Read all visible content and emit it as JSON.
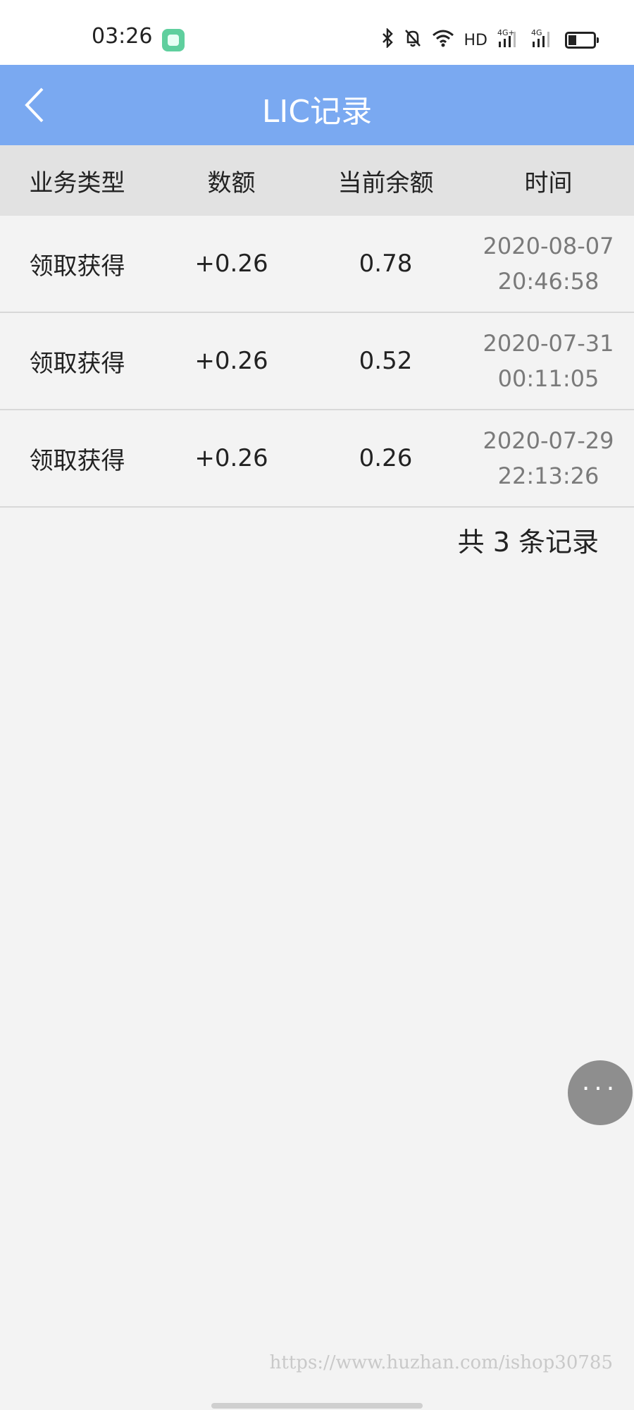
{
  "status_bar": {
    "time": "03:26",
    "icons": [
      "bluetooth-icon",
      "mute-icon",
      "wifi-icon",
      "hd-icon",
      "signal-4g-plus-icon",
      "signal-4g-icon",
      "battery-icon"
    ],
    "hd_label": "HD",
    "net1_label": "4G+",
    "net2_label": "4G"
  },
  "nav": {
    "title": "LIC记录",
    "back_icon": "chevron-left-icon"
  },
  "table": {
    "headers": [
      "业务类型",
      "数额",
      "当前余额",
      "时间"
    ],
    "rows": [
      {
        "type": "领取获得",
        "amount": "+0.26",
        "balance": "0.78",
        "date": "2020-08-07",
        "time": "20:46:58"
      },
      {
        "type": "领取获得",
        "amount": "+0.26",
        "balance": "0.52",
        "date": "2020-07-31",
        "time": "00:11:05"
      },
      {
        "type": "领取获得",
        "amount": "+0.26",
        "balance": "0.26",
        "date": "2020-07-29",
        "time": "22:13:26"
      }
    ]
  },
  "summary": {
    "total_text": "共 3 条记录"
  },
  "fab": {
    "label": "···",
    "icon": "more-icon"
  },
  "watermark": "https://www.huzhan.com/ishop30785",
  "colors": {
    "nav_bg": "#7aa9f1",
    "header_bg": "#e2e2e2",
    "page_bg": "#f3f3f3",
    "fab_bg": "#8e8e8e"
  }
}
